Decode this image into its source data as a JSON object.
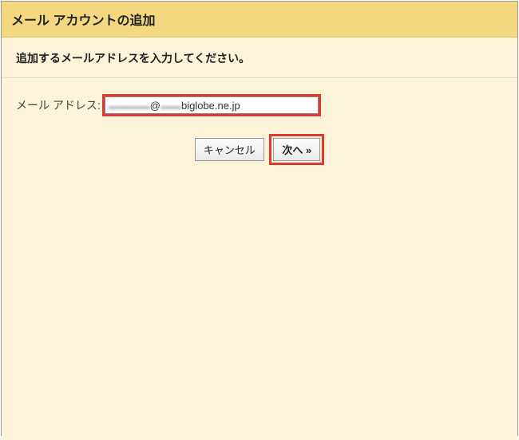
{
  "header": {
    "title": "メール アカウントの追加"
  },
  "instruction": "追加するメールアドレスを入力してください。",
  "form": {
    "emailLabel": "メール アドレス:",
    "emailValueObscured": "▬▬▬▬",
    "emailValueAt": "@",
    "emailValueObscured2": "▬▬",
    "emailValueDomain": " biglobe.ne.jp"
  },
  "buttons": {
    "cancel": "キャンセル",
    "next": "次へ »"
  }
}
